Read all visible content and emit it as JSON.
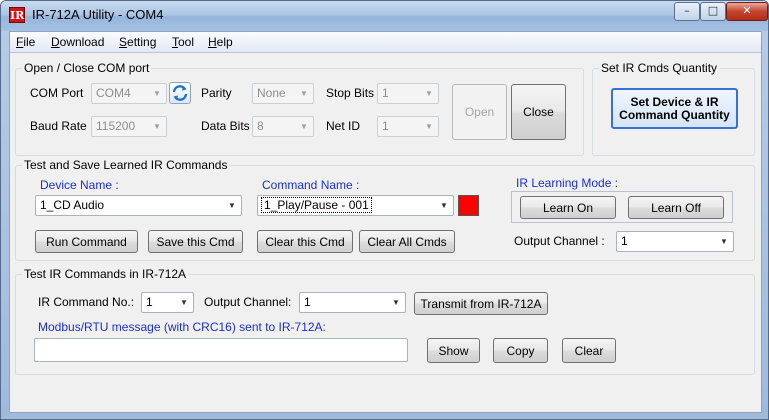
{
  "window": {
    "title": "IR-712A Utility - COM4",
    "icon": "IR",
    "min": "–",
    "max": "□",
    "close": "✕"
  },
  "menu": [
    {
      "label": "File"
    },
    {
      "label": "Download"
    },
    {
      "label": "Setting"
    },
    {
      "label": "Tool"
    },
    {
      "label": "Help"
    }
  ],
  "com": {
    "group_title": "Open / Close COM port",
    "com_port_label": "COM Port",
    "com_port_value": "COM4",
    "baud_label": "Baud Rate",
    "baud_value": "115200",
    "parity_label": "Parity",
    "parity_value": "None",
    "data_bits_label": "Data Bits",
    "data_bits_value": "8",
    "stop_bits_label": "Stop Bits",
    "stop_bits_value": "1",
    "net_id_label": "Net ID",
    "net_id_value": "1",
    "open_label": "Open",
    "close_label": "Close"
  },
  "qty": {
    "group_title": "Set IR Cmds Quantity",
    "button_line1": "Set Device & IR",
    "button_line2": "Command Quantity"
  },
  "learn": {
    "group_title": "Test and Save Learned IR Commands",
    "device_label": "Device Name :",
    "device_value": "1_CD Audio",
    "command_label": "Command Name :",
    "command_value": "1_Play/Pause - 001",
    "mode_label": "IR Learning Mode :",
    "learn_on": "Learn On",
    "learn_off": "Learn Off",
    "run": "Run Command",
    "save": "Save this Cmd",
    "clear_this": "Clear this Cmd",
    "clear_all": "Clear All Cmds",
    "output_label": "Output Channel :",
    "output_value": "1",
    "swatch_color": "#ff0000"
  },
  "test": {
    "group_title": "Test IR Commands in IR-712A",
    "cmd_no_label": "IR Command No.:",
    "cmd_no_value": "1",
    "out_label": "Output Channel:",
    "out_value": "1",
    "transmit": "Transmit from IR-712A",
    "modbus_label": "Modbus/RTU message (with CRC16) sent to IR-712A:",
    "modbus_value": "",
    "show": "Show",
    "copy": "Copy",
    "clear": "Clear"
  },
  "icons": {
    "dropdown": "▼",
    "refresh": "refresh-icon"
  }
}
